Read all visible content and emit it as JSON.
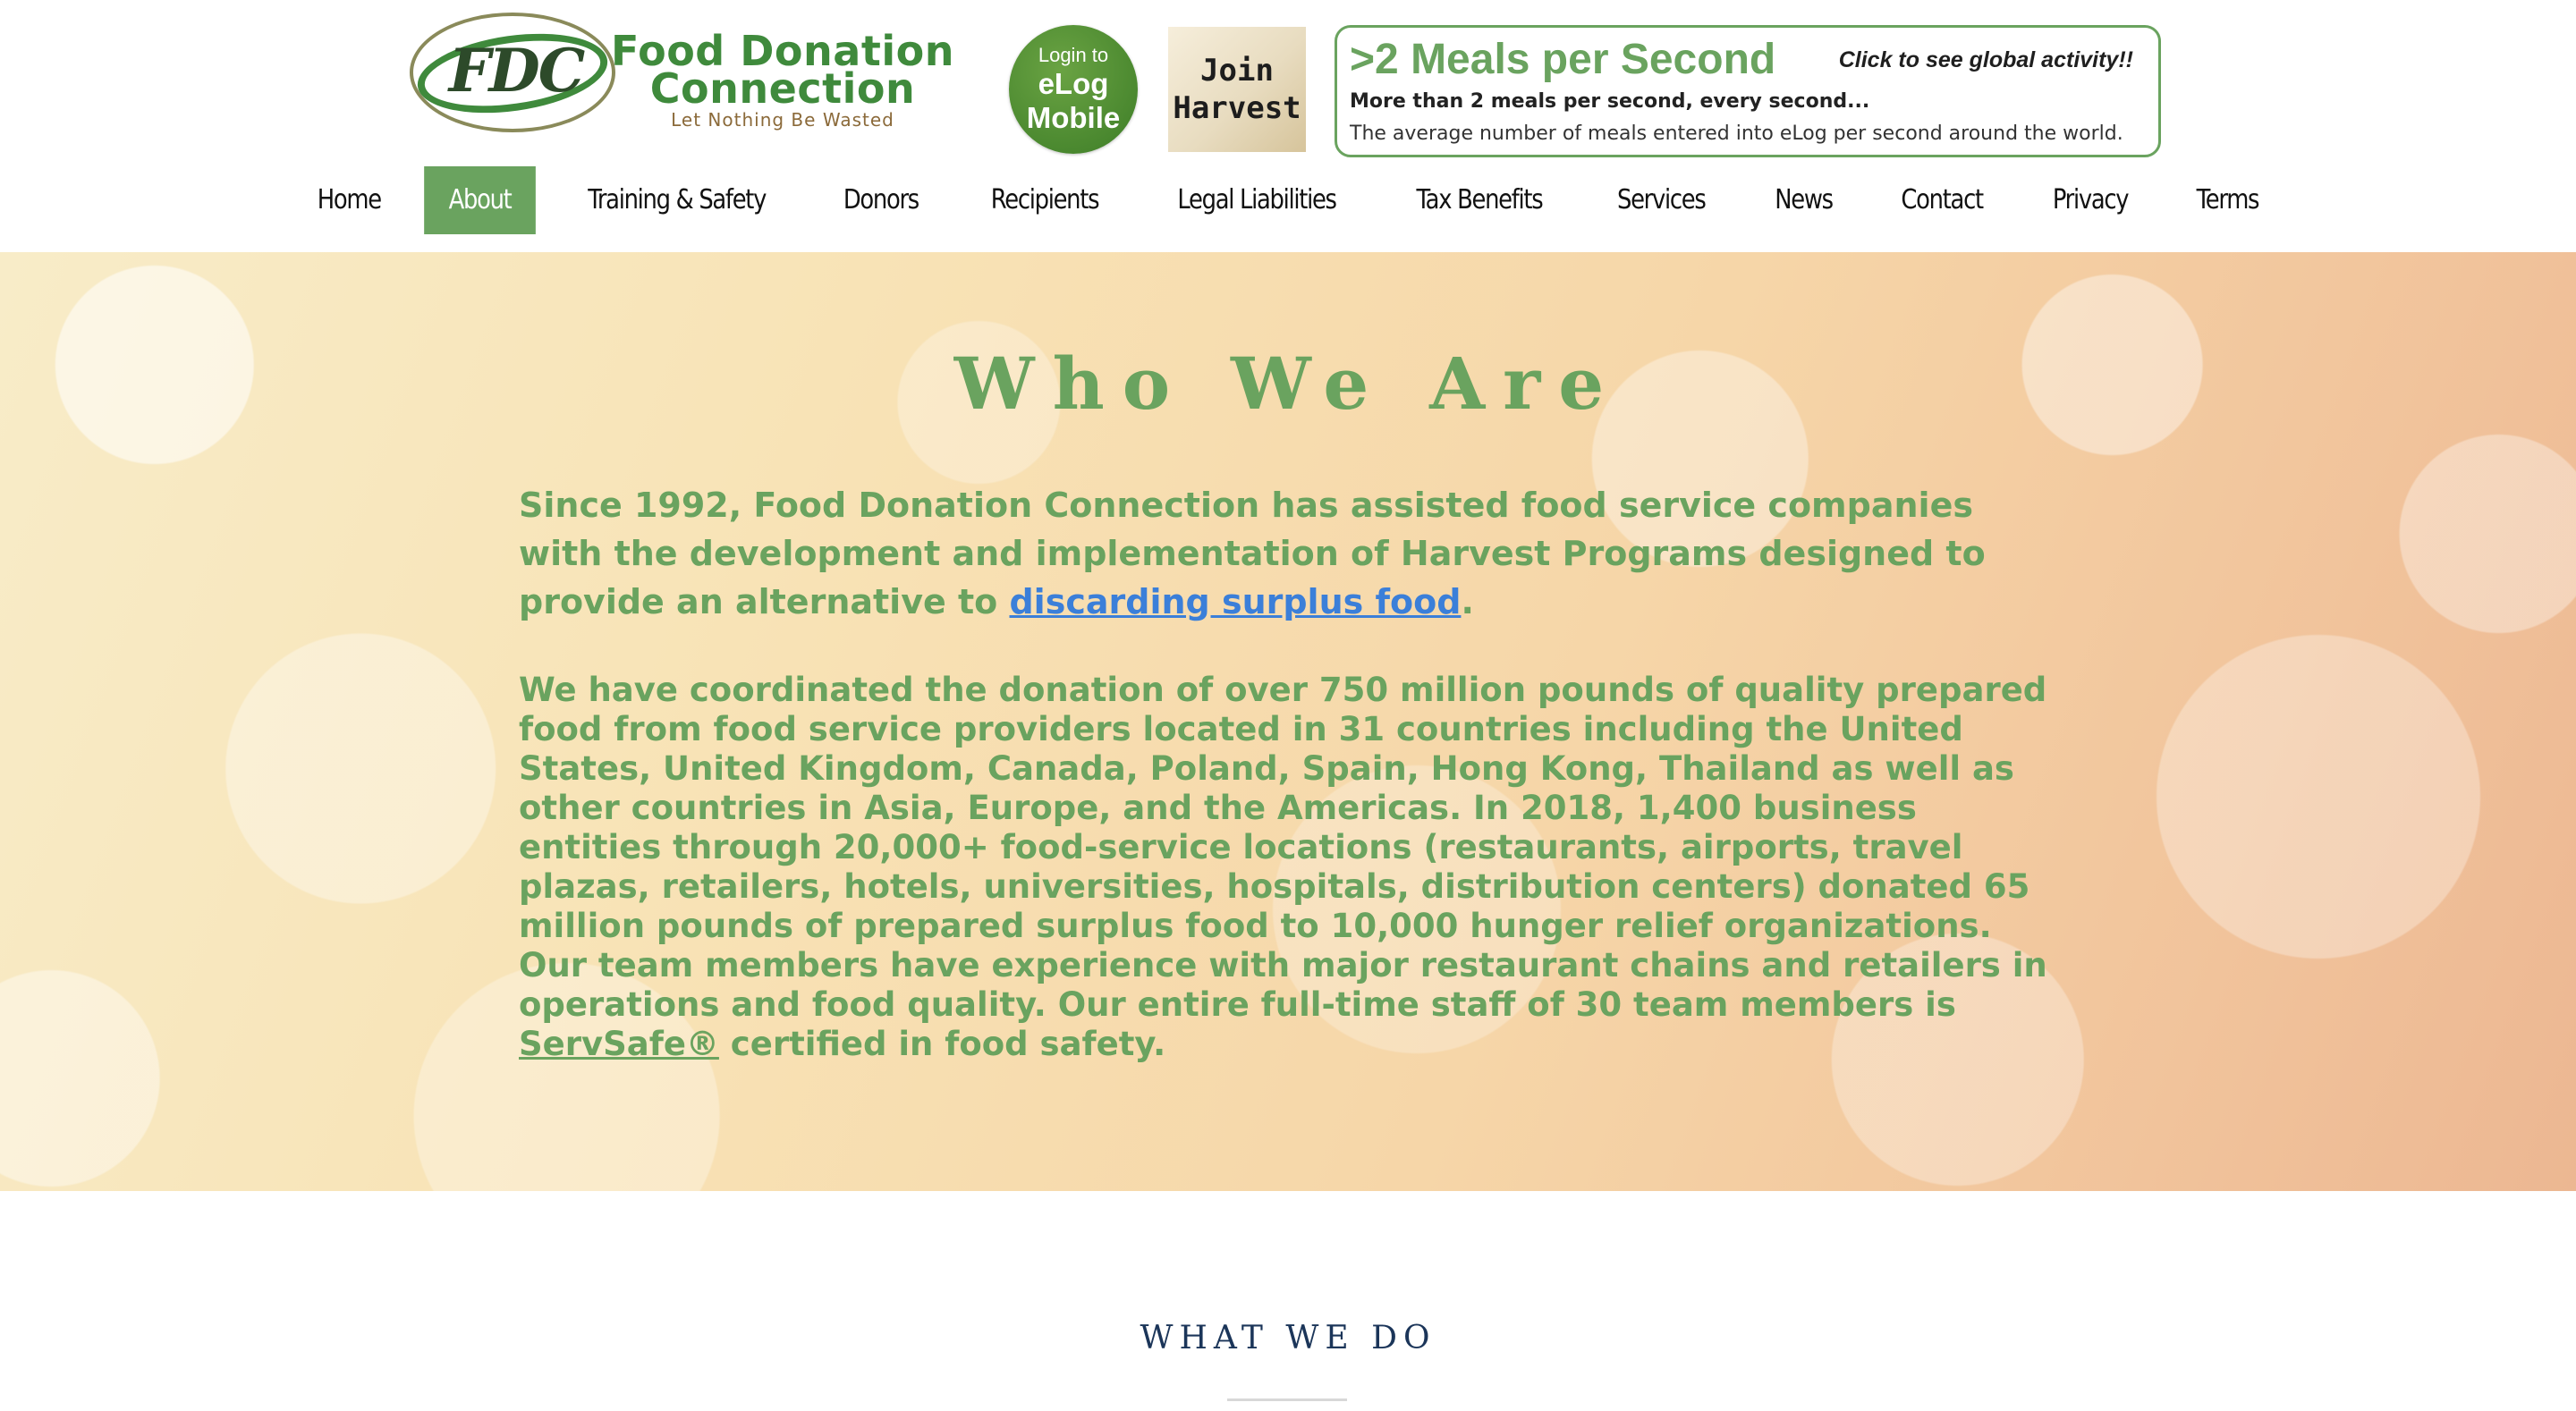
{
  "header": {
    "logo": {
      "mark": "FDC",
      "name_line1": "Food Donation",
      "name_line2": "Connection",
      "tagline": "Let Nothing Be Wasted"
    },
    "elog_button": {
      "line1": "Login to",
      "line2": "eLog",
      "line3": "Mobile"
    },
    "harvest_button": {
      "line1": "Join",
      "line2": "Harvest"
    },
    "meals_banner": {
      "headline": ">2 Meals per Second",
      "cta": "Click to see global activity!!",
      "subhead": "More than 2 meals per second, every second...",
      "description": "The average number of meals entered into eLog per second around the world."
    }
  },
  "nav": {
    "items": [
      {
        "label": "Home"
      },
      {
        "label": "About"
      },
      {
        "label": "Training & Safety"
      },
      {
        "label": "Donors"
      },
      {
        "label": "Recipients"
      },
      {
        "label": "Legal Liabilities"
      },
      {
        "label": "Tax Benefits"
      },
      {
        "label": "Services"
      },
      {
        "label": "News"
      },
      {
        "label": "Contact"
      },
      {
        "label": "Privacy"
      },
      {
        "label": "Terms"
      }
    ],
    "active": "About"
  },
  "hero": {
    "title": "Who We Are",
    "p1_before": "Since 1992, Food Donation Connection has assisted food service companies with the development and implementation of Harvest Programs designed to provide an alternative to ",
    "p1_link": "discarding surplus food",
    "p1_after": ".",
    "p2": "We have coordinated the donation of over 750 million pounds of quality prepared food from food service providers located in 31 countries including the United States, United Kingdom, Canada, Poland, Spain, Hong Kong, Thailand as well as other countries in Asia, Europe, and the Americas. In 2018, 1,400 business entities through 20,000+ food-service locations (restaurants, airports, travel plazas, retailers, hotels, universities, hospitals, distribution centers) donated 65 million pounds of prepared surplus food to 10,000 hunger relief organizations.",
    "p3_before": "Our team members have experience with major restaurant chains and retailers in operations and food quality. Our entire full-time staff of 30 team members is ",
    "p3_link": "ServSafe®",
    "p3_after": " certified in food safety."
  },
  "what_we_do": {
    "title": "WHAT WE DO"
  },
  "colors": {
    "brand_green": "#6aa35f",
    "link_blue": "#3b7fd9",
    "heading_navy": "#1b3559"
  }
}
